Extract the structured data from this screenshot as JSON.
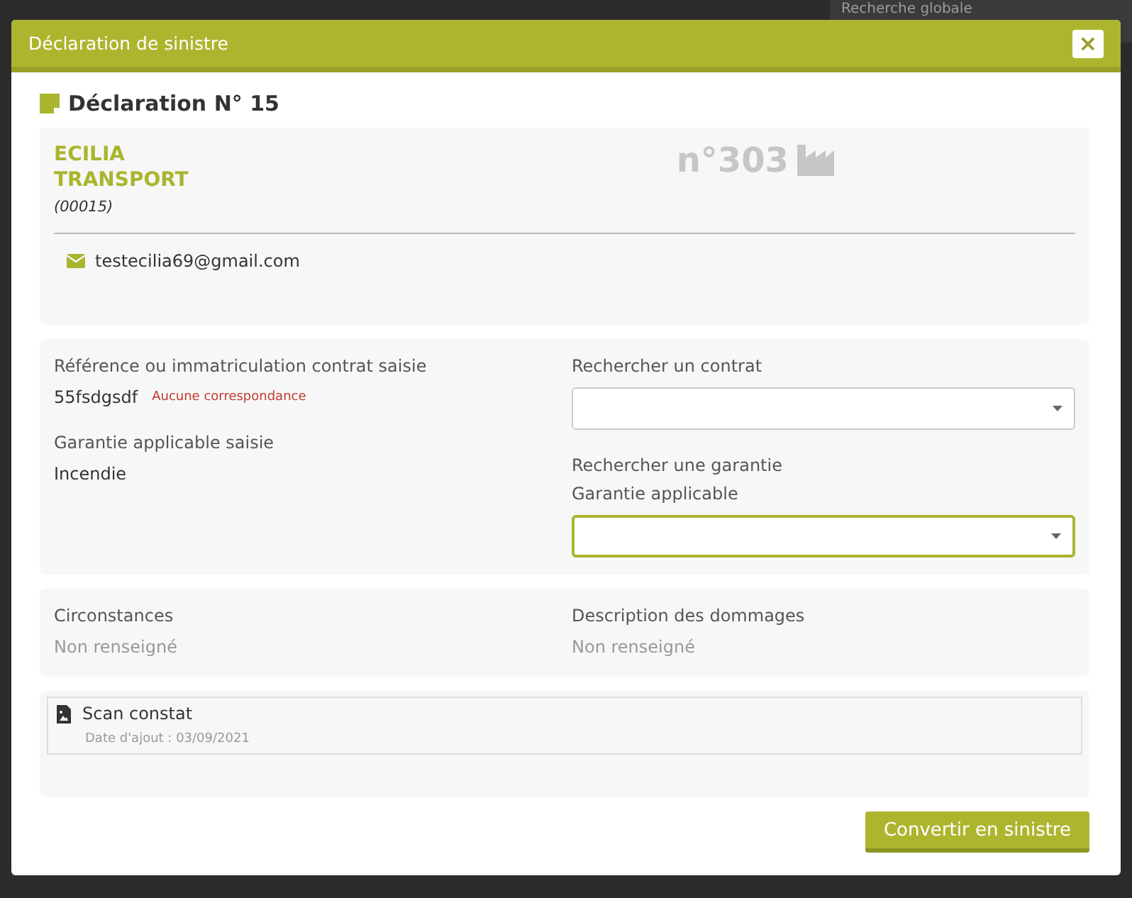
{
  "background": {
    "search_label": "Recherche globale"
  },
  "modal": {
    "title": "Déclaration de sinistre",
    "close": "×"
  },
  "heading": "Déclaration N° 15",
  "company": {
    "name_lines": [
      "ECILIA",
      "TRANSPORT"
    ],
    "code": "(00015)",
    "number": "n°303",
    "email": "testecilia69@gmail.com"
  },
  "contract": {
    "left": [
      {
        "label": "Référence ou immatriculation contrat saisie",
        "value": "55fsdgsdf",
        "note": "Aucune correspondance"
      },
      {
        "label": "Garantie applicable saisie",
        "value": "Incendie"
      }
    ],
    "right": [
      {
        "label": "Rechercher un contrat",
        "fields": [
          {
            "focused": false
          }
        ]
      },
      {
        "label": "Rechercher une garantie",
        "sublabel": "Garantie applicable",
        "fields": [
          {
            "focused": true
          }
        ]
      }
    ]
  },
  "details": [
    {
      "label": "Circonstances",
      "value": "Non renseigné"
    },
    {
      "label": "Description des dommages",
      "value": "Non renseigné"
    }
  ],
  "attachments": [
    {
      "name": "Scan constat",
      "date": "Date d'ajout : 03/09/2021"
    }
  ],
  "buttons": [
    "Convertir en sinistre"
  ]
}
